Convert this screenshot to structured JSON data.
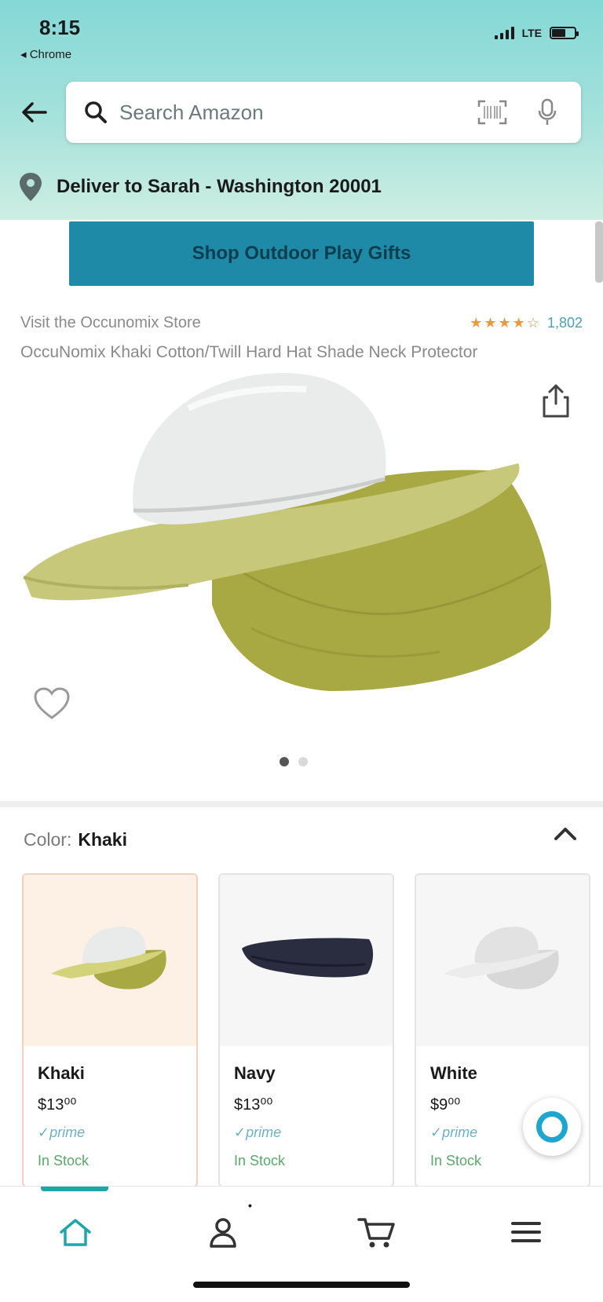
{
  "status_bar": {
    "time": "8:15",
    "back_app": "◂ Chrome",
    "network": "LTE"
  },
  "search": {
    "placeholder": "Search Amazon"
  },
  "delivery": {
    "text": "Deliver to Sarah - Washington 20001"
  },
  "promo": {
    "label": "Shop Outdoor Play Gifts"
  },
  "product": {
    "store_link": "Visit the Occunomix Store",
    "rating_stars": "★★★★☆",
    "rating_count": "1,802",
    "title": "OccuNomix Khaki Cotton/Twill Hard Hat Shade Neck Protector"
  },
  "carousel": {
    "total_images": 2,
    "active_index": 0
  },
  "color_selector": {
    "label": "Color:",
    "value": "Khaki"
  },
  "swatches": [
    {
      "name": "Khaki",
      "price": "$13⁰⁰",
      "prime": "✓prime",
      "stock": "In Stock",
      "selected": true
    },
    {
      "name": "Navy",
      "price": "$13⁰⁰",
      "prime": "✓prime",
      "stock": "In Stock",
      "selected": false
    },
    {
      "name": "White",
      "price": "$9⁰⁰",
      "prime": "✓prime",
      "stock": "In Stock",
      "selected": false
    }
  ],
  "nav": {
    "items": [
      "home-icon",
      "account-icon",
      "cart-icon",
      "menu-icon"
    ],
    "active": "home-icon",
    "account_badge": "•"
  },
  "colors": {
    "header_top": "#84d8d6",
    "promo_bg": "#1e8aa8",
    "accent": "#1ea6a8",
    "alexa": "#1ea6cf"
  }
}
